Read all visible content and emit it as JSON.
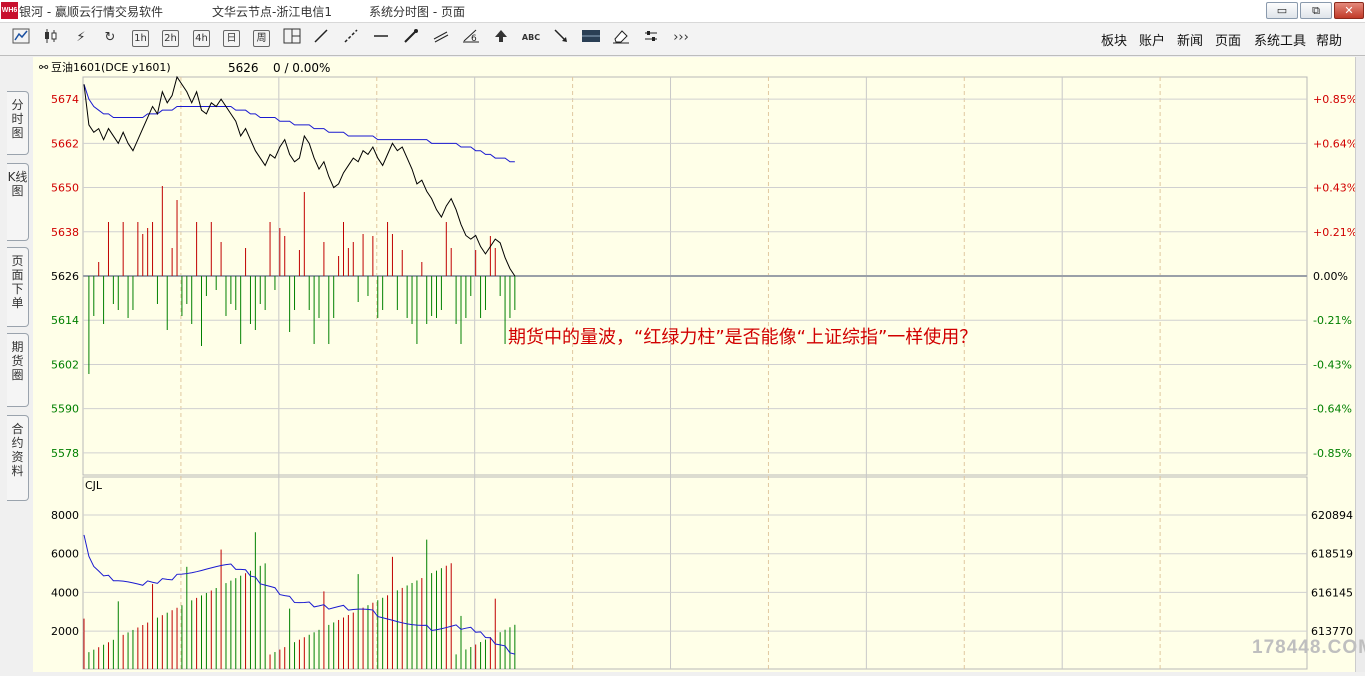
{
  "window": {
    "logo": "WH6",
    "title_parts": [
      "银河  -  赢顺云行情交易软件",
      "文华云节点-浙江电信1",
      "系统分时图  -  页面"
    ],
    "controls": [
      "▭",
      "⧉",
      "✕"
    ]
  },
  "toolbar": {
    "tools": [
      "1h",
      "2h",
      "4h",
      "日",
      "周",
      "ABC",
      "›››"
    ],
    "menu": [
      "板块",
      "账户",
      "新闻",
      "页面",
      "系统工具",
      "帮助"
    ]
  },
  "side_tabs": [
    "分时图",
    "K线图",
    "页面下单",
    "期货圈",
    "合约资料"
  ],
  "quote": {
    "symbol": "豆油1601(DCE y1601)",
    "price": "5626",
    "change": "0 / 0.00%"
  },
  "price_axis": {
    "labels": [
      "5674",
      "5662",
      "5650",
      "5638",
      "5626",
      "5614",
      "5602",
      "5590",
      "5578"
    ],
    "percent_labels": [
      "+0.85%",
      "+0.64%",
      "+0.43%",
      "+0.21%",
      "0.00%",
      "-0.21%",
      "-0.43%",
      "-0.64%",
      "-0.85%"
    ],
    "colors": {
      "up": "#d10000",
      "down": "#008000",
      "flat": "#000000"
    }
  },
  "volume_panel": {
    "indicator": "CJL",
    "left_labels": [
      "8000",
      "6000",
      "4000",
      "2000"
    ],
    "right_labels": [
      "620894",
      "618519",
      "616145",
      "613770"
    ]
  },
  "annotation": "期货中的量波，“红绿力柱”是否能像“上证综指”一样使用？",
  "watermark": "178448.COM",
  "chart_data": {
    "type": "line",
    "price_range": [
      5572,
      5680
    ],
    "base_price": 5626,
    "minutes_total": 250,
    "price": [
      5678,
      5667,
      5665,
      5666,
      5663,
      5666,
      5664,
      5662,
      5665,
      5662,
      5660,
      5663,
      5666,
      5669,
      5672,
      5670,
      5676,
      5673,
      5675,
      5680,
      5678,
      5676,
      5673,
      5676,
      5671,
      5670,
      5673,
      5672,
      5674,
      5672,
      5670,
      5668,
      5664,
      5666,
      5663,
      5660,
      5658,
      5656,
      5659,
      5658,
      5661,
      5663,
      5659,
      5657,
      5658,
      5664,
      5662,
      5658,
      5655,
      5657,
      5653,
      5650,
      5651,
      5654,
      5656,
      5658,
      5657,
      5660,
      5659,
      5661,
      5658,
      5656,
      5659,
      5662,
      5660,
      5661,
      5658,
      5655,
      5651,
      5652,
      5649,
      5647,
      5644,
      5642,
      5645,
      5647,
      5644,
      5640,
      5637,
      5636,
      5637,
      5634,
      5632,
      5634,
      5636,
      5635,
      5631,
      5628,
      5626
    ],
    "avg_price": [
      5678,
      5674,
      5672,
      5671,
      5670,
      5670,
      5669,
      5669,
      5669,
      5669,
      5669,
      5669,
      5669,
      5670,
      5670,
      5670,
      5671,
      5671,
      5671,
      5672,
      5672,
      5672,
      5672,
      5672,
      5672,
      5672,
      5672,
      5672,
      5672,
      5672,
      5672,
      5671,
      5671,
      5671,
      5670,
      5670,
      5669,
      5669,
      5669,
      5669,
      5668,
      5668,
      5668,
      5667,
      5667,
      5667,
      5667,
      5666,
      5666,
      5666,
      5665,
      5665,
      5665,
      5665,
      5664,
      5664,
      5664,
      5664,
      5664,
      5664,
      5663,
      5663,
      5663,
      5663,
      5663,
      5663,
      5663,
      5663,
      5663,
      5663,
      5663,
      5662,
      5662,
      5662,
      5662,
      5662,
      5662,
      5661,
      5661,
      5661,
      5660,
      5660,
      5659,
      5659,
      5658,
      5658,
      5658,
      5657,
      5657
    ],
    "cjl_range": [
      0,
      9000
    ],
    "oi_range": [
      612800,
      622500
    ]
  }
}
